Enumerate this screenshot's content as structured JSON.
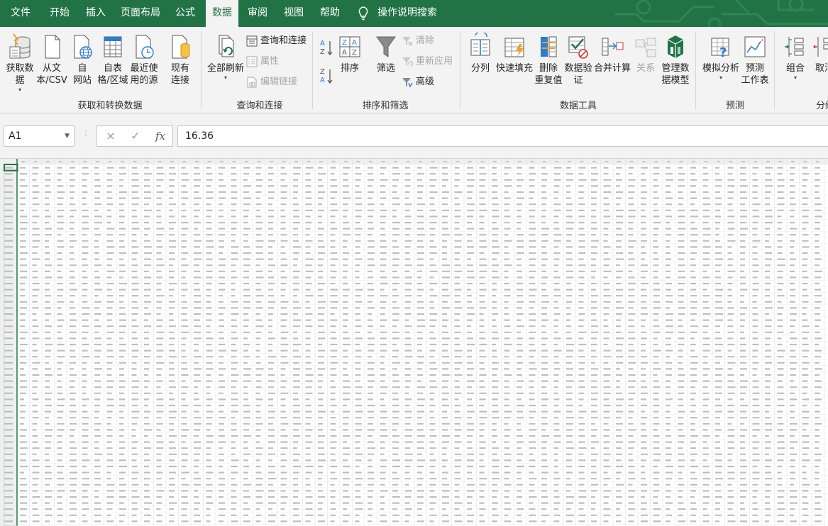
{
  "tabs": [
    {
      "label": "文件",
      "active": false
    },
    {
      "label": "开始",
      "active": false
    },
    {
      "label": "插入",
      "active": false
    },
    {
      "label": "页面布局",
      "active": false
    },
    {
      "label": "公式",
      "active": false
    },
    {
      "label": "数据",
      "active": true
    },
    {
      "label": "审阅",
      "active": false
    },
    {
      "label": "视图",
      "active": false
    },
    {
      "label": "帮助",
      "active": false
    }
  ],
  "tell_me": {
    "label": "操作说明搜索",
    "icon": "lightbulb-icon"
  },
  "ribbon": {
    "groups": [
      {
        "label": "获取和转换数据",
        "buttons": [
          {
            "label": "获取数\n据",
            "icon": "database-icon",
            "dropdown": true
          },
          {
            "label": "从文\n本/CSV",
            "icon": "text-file-icon"
          },
          {
            "label": "自\n网站",
            "icon": "web-icon"
          },
          {
            "label": "自表\n格/区域",
            "icon": "table-icon"
          },
          {
            "label": "最近使\n用的源",
            "icon": "recent-sources-icon"
          },
          {
            "label": "现有\n连接",
            "icon": "existing-connections-icon"
          }
        ]
      },
      {
        "label": "查询和连接",
        "refresh_all": {
          "label": "全部刷新",
          "icon": "refresh-icon",
          "dropdown": true
        },
        "small": [
          {
            "label": "查询和连接",
            "icon": "queries-icon",
            "enabled": true
          },
          {
            "label": "属性",
            "icon": "properties-icon",
            "enabled": false
          },
          {
            "label": "编辑链接",
            "icon": "edit-links-icon",
            "enabled": false
          }
        ]
      },
      {
        "label": "排序和筛选",
        "sort_az": {
          "icon": "sort-az-icon"
        },
        "sort_za": {
          "icon": "sort-za-icon"
        },
        "sort": {
          "label": "排序",
          "icon": "sort-icon"
        },
        "filter": {
          "label": "筛选",
          "icon": "filter-icon"
        },
        "small": [
          {
            "label": "清除",
            "icon": "clear-filter-icon",
            "enabled": false
          },
          {
            "label": "重新应用",
            "icon": "reapply-icon",
            "enabled": false
          },
          {
            "label": "高级",
            "icon": "advanced-filter-icon",
            "enabled": true
          }
        ]
      },
      {
        "label": "数据工具",
        "buttons": [
          {
            "label": "分列",
            "icon": "text-to-columns-icon",
            "enabled": true
          },
          {
            "label": "快速填充",
            "icon": "flash-fill-icon",
            "enabled": true
          },
          {
            "label": "删除\n重复值",
            "icon": "remove-duplicates-icon",
            "enabled": true
          },
          {
            "label": "数据验\n证",
            "icon": "data-validation-icon",
            "enabled": true,
            "dropdown": true
          },
          {
            "label": "合并计算",
            "icon": "consolidate-icon",
            "enabled": true
          },
          {
            "label": "关系",
            "icon": "relationships-icon",
            "enabled": false
          },
          {
            "label": "管理数\n据模型",
            "icon": "data-model-icon",
            "enabled": true
          }
        ]
      },
      {
        "label": "预测",
        "buttons": [
          {
            "label": "模拟分析",
            "icon": "what-if-icon",
            "dropdown": true
          },
          {
            "label": "预测\n工作表",
            "icon": "forecast-sheet-icon"
          }
        ]
      },
      {
        "label": "分级",
        "buttons": [
          {
            "label": "组合",
            "icon": "group-icon",
            "dropdown": true
          },
          {
            "label": "取消",
            "icon": "ungroup-icon"
          }
        ]
      }
    ]
  },
  "formula_bar": {
    "name_box": "A1",
    "cancel_icon": "×",
    "enter_icon": "✓",
    "fx_label": "fx",
    "value": "16.36"
  },
  "colors": {
    "brand": "#217346",
    "ribbon_bg": "#f3f3f3",
    "grid_line": "#e1e1e1",
    "cell_text": "#555555",
    "header_text": "#888888"
  }
}
